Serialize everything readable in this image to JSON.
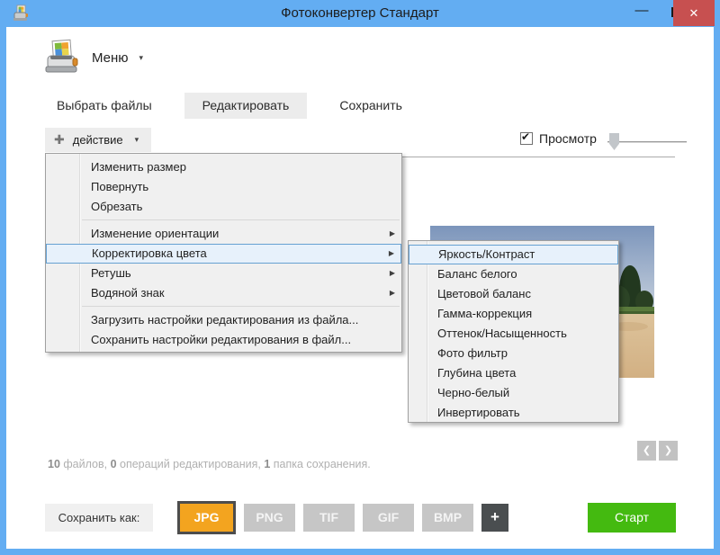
{
  "window": {
    "title": "Фотоконвертер Стандарт"
  },
  "icons": {
    "caret_down": "▾",
    "plus": "✚",
    "menu_arrow": "▶",
    "chevron_left": "❮",
    "chevron_right": "❯",
    "check": "✔",
    "minimize": "—",
    "close": "✕"
  },
  "header": {
    "menu_label": "Меню"
  },
  "tabs": [
    {
      "name": "tab-select-files",
      "label": "Выбрать файлы",
      "active": false
    },
    {
      "name": "tab-edit",
      "label": "Редактировать",
      "active": true
    },
    {
      "name": "tab-save",
      "label": "Сохранить",
      "active": false
    }
  ],
  "toolbar": {
    "action_label": "действие",
    "preview_label": "Просмотр",
    "preview_checked": true
  },
  "action_menu": {
    "items": [
      {
        "type": "item",
        "name": "menu-item-resize",
        "label": "Изменить размер"
      },
      {
        "type": "item",
        "name": "menu-item-rotate",
        "label": "Повернуть"
      },
      {
        "type": "item",
        "name": "menu-item-crop",
        "label": "Обрезать"
      },
      {
        "type": "separator"
      },
      {
        "type": "submenu",
        "name": "menu-item-orientation",
        "label": "Изменение ориентации"
      },
      {
        "type": "submenu",
        "name": "menu-item-color-correction",
        "label": "Корректировка цвета",
        "highlighted": true
      },
      {
        "type": "submenu",
        "name": "menu-item-retouch",
        "label": "Ретушь"
      },
      {
        "type": "submenu",
        "name": "menu-item-watermark",
        "label": "Водяной знак"
      },
      {
        "type": "separator"
      },
      {
        "type": "item",
        "name": "menu-item-load-settings",
        "label": "Загрузить настройки редактирования из файла..."
      },
      {
        "type": "item",
        "name": "menu-item-save-settings",
        "label": "Сохранить настройки редактирования в файл..."
      }
    ]
  },
  "color_submenu": {
    "items": [
      {
        "name": "submenu-item-brightness-contrast",
        "label": "Яркость/Контраст",
        "highlighted": true
      },
      {
        "name": "submenu-item-white-balance",
        "label": "Баланс белого",
        "highlighted": false
      },
      {
        "name": "submenu-item-color-balance",
        "label": "Цветовой баланс",
        "highlighted": false
      },
      {
        "name": "submenu-item-gamma",
        "label": "Гамма-коррекция",
        "highlighted": false
      },
      {
        "name": "submenu-item-hue-saturation",
        "label": "Оттенок/Насыщенность",
        "highlighted": false
      },
      {
        "name": "submenu-item-photo-filter",
        "label": "Фото фильтр",
        "highlighted": false
      },
      {
        "name": "submenu-item-color-depth",
        "label": "Глубина цвета",
        "highlighted": false
      },
      {
        "name": "submenu-item-black-white",
        "label": "Черно-белый",
        "highlighted": false
      },
      {
        "name": "submenu-item-invert",
        "label": "Инвертировать",
        "highlighted": false
      }
    ]
  },
  "status": {
    "counts": [
      {
        "value": "10",
        "label": "файлов,"
      },
      {
        "value": "0",
        "label": "операций редактирования,"
      },
      {
        "value": "1",
        "label": "папка сохранения."
      }
    ]
  },
  "footer": {
    "save_as_label": "Сохранить как:",
    "formats": [
      {
        "name": "format-jpg",
        "label": "JPG",
        "selected": true
      },
      {
        "name": "format-png",
        "label": "PNG",
        "selected": false
      },
      {
        "name": "format-tif",
        "label": "TIF",
        "selected": false
      },
      {
        "name": "format-gif",
        "label": "GIF",
        "selected": false
      },
      {
        "name": "format-bmp",
        "label": "BMP",
        "selected": false
      }
    ],
    "add_format_label": "+",
    "start_label": "Старт"
  },
  "colors": {
    "titlebar_blue": "#63ADF2",
    "close_red": "#C75050",
    "selected_format_orange": "#F3A41F",
    "start_green": "#44BA10",
    "menu_highlight_fill": "#E7F1FB",
    "menu_highlight_border": "#66A1D2"
  }
}
